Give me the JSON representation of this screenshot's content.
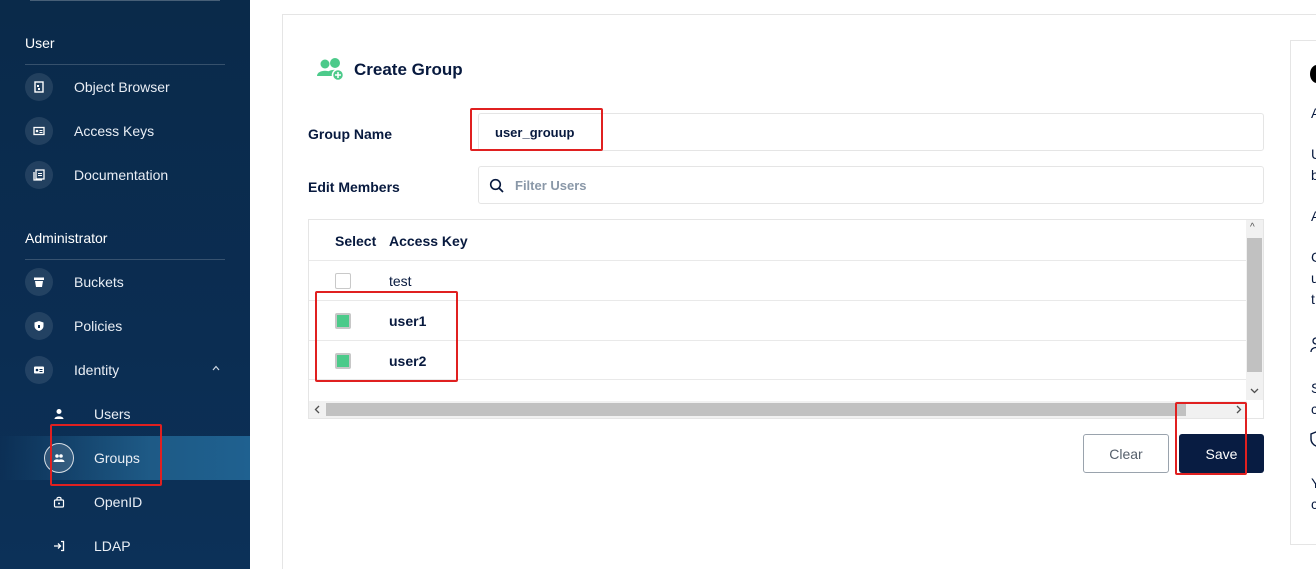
{
  "sidebar": {
    "sections": {
      "user": "User",
      "administrator": "Administrator"
    },
    "items": [
      {
        "label": "Object Browser",
        "icon": "object-browser-icon"
      },
      {
        "label": "Access Keys",
        "icon": "access-keys-icon"
      },
      {
        "label": "Documentation",
        "icon": "documentation-icon"
      },
      {
        "label": "Buckets",
        "icon": "buckets-icon"
      },
      {
        "label": "Policies",
        "icon": "policies-icon"
      },
      {
        "label": "Identity",
        "icon": "identity-icon"
      }
    ],
    "identity_sub": [
      {
        "label": "Users",
        "icon": "user-icon"
      },
      {
        "label": "Groups",
        "icon": "groups-icon",
        "active": true
      },
      {
        "label": "OpenID",
        "icon": "openid-icon"
      },
      {
        "label": "LDAP",
        "icon": "ldap-icon"
      }
    ]
  },
  "form": {
    "title": "Create Group",
    "group_name_label": "Group Name",
    "group_name_value": "user_grouup",
    "edit_members_label": "Edit Members",
    "filter_placeholder": "Filter Users"
  },
  "table": {
    "columns": [
      "Select",
      "Access Key"
    ],
    "rows": [
      {
        "access_key": "test",
        "selected": false
      },
      {
        "access_key": "user1",
        "selected": true
      },
      {
        "access_key": "user2",
        "selected": true
      }
    ]
  },
  "buttons": {
    "clear": "Clear",
    "save": "Save"
  },
  "help_panel": {
    "visible_chars": [
      "A",
      "U",
      "b",
      "A",
      "C",
      "u",
      "t",
      "S",
      "c",
      "Y",
      "c"
    ]
  },
  "colors": {
    "sidebar_bg": "#0b2d52",
    "accent_green": "#4cca8a",
    "save_button": "#081c42",
    "annotation_red": "#e02020"
  }
}
